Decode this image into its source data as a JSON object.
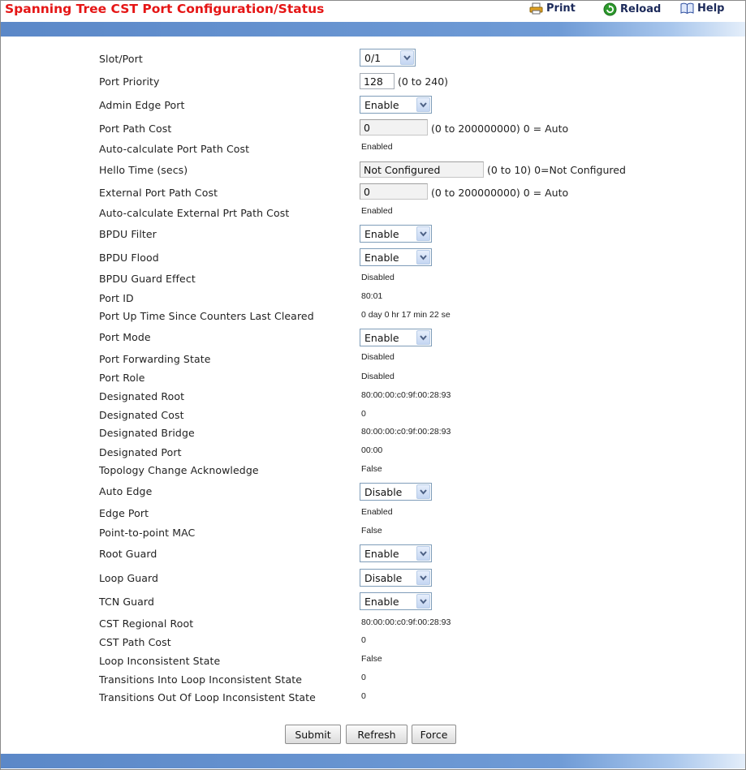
{
  "header": {
    "title": "Spanning Tree CST Port Configuration/Status",
    "links": {
      "print": "Print",
      "reload": "Reload",
      "help": "Help"
    }
  },
  "fields": {
    "slot_port": {
      "label": "Slot/Port",
      "value": "0/1"
    },
    "port_priority": {
      "label": "Port Priority",
      "value": "128",
      "hint": "(0 to 240)"
    },
    "admin_edge_port": {
      "label": "Admin Edge Port",
      "value": "Enable"
    },
    "port_path_cost": {
      "label": "Port Path Cost",
      "value": "0",
      "hint": "(0 to 200000000) 0 = Auto"
    },
    "auto_calc_port_path_cost": {
      "label": "Auto-calculate Port Path Cost",
      "value": "Enabled"
    },
    "hello_time": {
      "label": "Hello Time (secs)",
      "value": "Not Configured",
      "hint": "(0 to 10) 0=Not Configured"
    },
    "external_port_path_cost": {
      "label": "External Port Path Cost",
      "value": "0",
      "hint": "(0 to 200000000) 0 = Auto"
    },
    "auto_calc_external_path_cost": {
      "label": "Auto-calculate External Prt Path Cost",
      "value": "Enabled"
    },
    "bpdu_filter": {
      "label": "BPDU Filter",
      "value": "Enable"
    },
    "bpdu_flood": {
      "label": "BPDU Flood",
      "value": "Enable"
    },
    "bpdu_guard_effect": {
      "label": "BPDU Guard Effect",
      "value": "Disabled"
    },
    "port_id": {
      "label": "Port ID",
      "value": "80:01"
    },
    "port_up_time": {
      "label": "Port Up Time Since Counters Last Cleared",
      "value": "0 day 0 hr 17 min 22 se"
    },
    "port_mode": {
      "label": "Port Mode",
      "value": "Enable"
    },
    "port_forwarding_state": {
      "label": "Port Forwarding State",
      "value": "Disabled"
    },
    "port_role": {
      "label": "Port Role",
      "value": "Disabled"
    },
    "designated_root": {
      "label": "Designated Root",
      "value": "80:00:00:c0:9f:00:28:93"
    },
    "designated_cost": {
      "label": "Designated Cost",
      "value": "0"
    },
    "designated_bridge": {
      "label": "Designated Bridge",
      "value": "80:00:00:c0:9f:00:28:93"
    },
    "designated_port": {
      "label": "Designated Port",
      "value": "00:00"
    },
    "topology_change_ack": {
      "label": "Topology Change Acknowledge",
      "value": "False"
    },
    "auto_edge": {
      "label": "Auto Edge",
      "value": "Disable"
    },
    "edge_port": {
      "label": "Edge Port",
      "value": "Enabled"
    },
    "point_to_point_mac": {
      "label": "Point-to-point MAC",
      "value": "False"
    },
    "root_guard": {
      "label": "Root Guard",
      "value": "Enable"
    },
    "loop_guard": {
      "label": "Loop Guard",
      "value": "Disable"
    },
    "tcn_guard": {
      "label": "TCN Guard",
      "value": "Enable"
    },
    "cst_regional_root": {
      "label": "CST Regional Root",
      "value": "80:00:00:c0:9f:00:28:93"
    },
    "cst_path_cost": {
      "label": "CST Path Cost",
      "value": "0"
    },
    "loop_inconsistent_state": {
      "label": "Loop Inconsistent State",
      "value": "False"
    },
    "transitions_into_loop": {
      "label": "Transitions Into Loop Inconsistent State",
      "value": "0"
    },
    "transitions_out_of_loop": {
      "label": "Transitions Out Of Loop Inconsistent State",
      "value": "0"
    }
  },
  "buttons": {
    "submit": "Submit",
    "refresh": "Refresh",
    "force": "Force"
  },
  "colors": {
    "title": "#e51515",
    "bar": "#6f9bd6",
    "print_icon": "#e0a020",
    "reload_icon": "#2d9a2d",
    "help_icon": "#2f4f9f"
  },
  "icons": {
    "print": "printer-icon",
    "reload": "reload-icon",
    "help": "help-book-icon"
  }
}
